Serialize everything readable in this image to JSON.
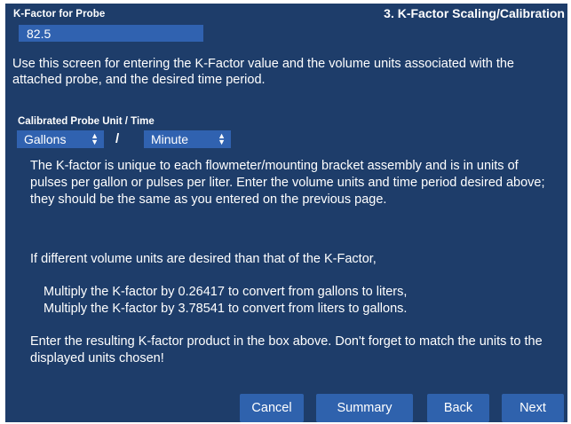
{
  "header": {
    "kfactor_label": "K-Factor for Probe",
    "title": "3. K-Factor Scaling/Calibration"
  },
  "kfactor_input": {
    "value": "82.5"
  },
  "intro_text": "Use this screen for entering the K-Factor value and the volume units associated with the attached probe, and the desired time period.",
  "unit_section": {
    "label": "Calibrated Probe Unit / Time",
    "volume_unit": "Gallons",
    "separator": "/",
    "time_unit": "Minute"
  },
  "body": {
    "paragraph1": "The K-factor is unique to each flowmeter/mounting bracket assembly and is in units of pulses per gallon or pulses per liter. Enter the volume units and time period desired above; they should be the same as you entered on the previous page.",
    "paragraph2": "If different volume units are desired than that of the K-Factor,",
    "conversion_line1": "Multiply the K-factor by 0.26417 to convert from gallons to liters,",
    "conversion_line2": "Multiply the K-factor by 3.78541 to convert from liters to gallons.",
    "paragraph4": "Enter the resulting K-factor product in the box above. Don't forget to match the units to the displayed units chosen!"
  },
  "buttons": {
    "cancel": "Cancel",
    "summary": "Summary",
    "back": "Back",
    "next": "Next"
  },
  "colors": {
    "panel_background": "#1e3d6a",
    "field_background": "#3062b0",
    "button_background": "#2f62ad",
    "text": "#ffffff"
  }
}
